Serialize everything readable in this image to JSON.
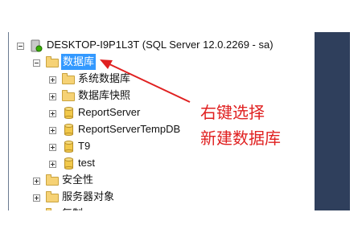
{
  "tree": {
    "server": "DESKTOP-I9P1L3T (SQL Server 12.0.2269 - sa)",
    "databases": "数据库",
    "db_children": [
      "系统数据库",
      "数据库快照",
      "ReportServer",
      "ReportServerTempDB",
      "T9",
      "test"
    ],
    "security": "安全性",
    "server_objects": "服务器对象",
    "replication": "复制"
  },
  "annotation": {
    "line1": "右键选择",
    "line2": "新建数据库"
  },
  "colors": {
    "selection": "#3399ff",
    "annotation": "#e02020",
    "right_strip": "#2f3f5c"
  }
}
